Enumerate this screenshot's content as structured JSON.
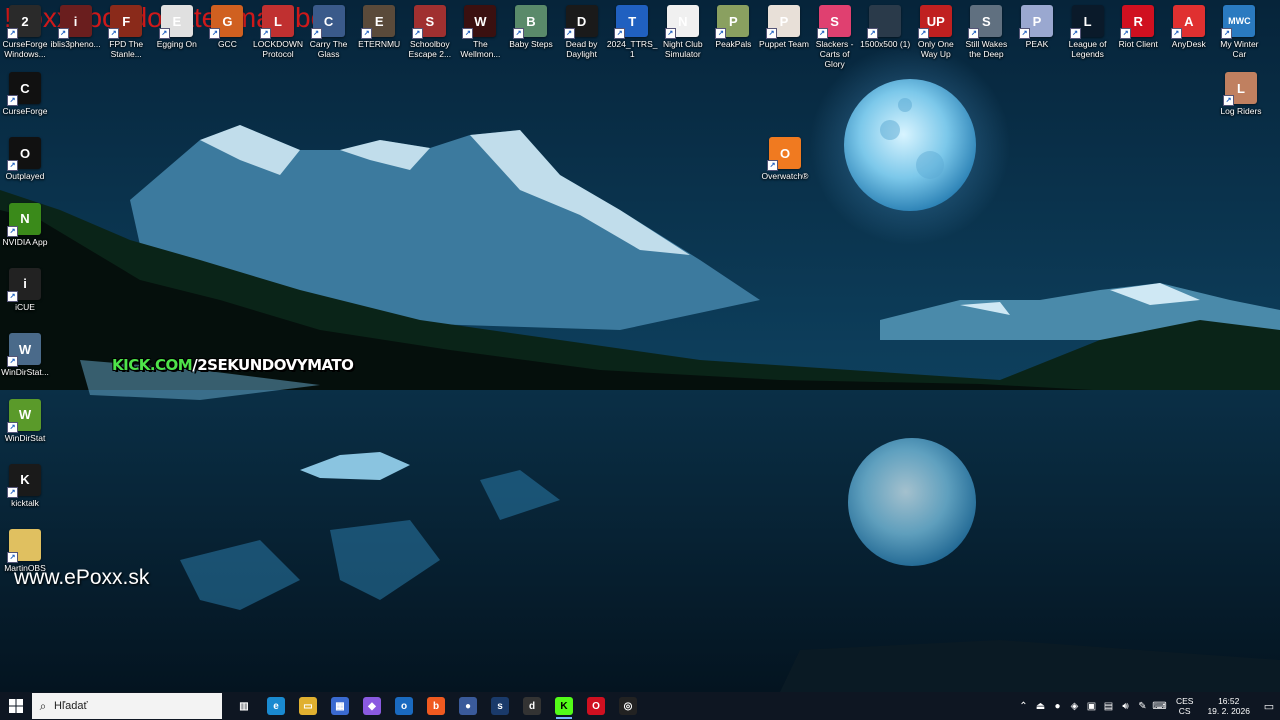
{
  "overlays": {
    "top_banner": "!doxx !pc !donate !matobot",
    "kick_prefix": "KICK.COM",
    "kick_suffix": "/2SEKUNDOVYMATO",
    "website": "www.ePoxx.sk"
  },
  "desktop_icons_top": [
    {
      "name": "curseforge-windows",
      "label": "CurseForge Windows...",
      "glyph": "2",
      "color": "#2a2a2a"
    },
    {
      "name": "iblis3phenomenon",
      "label": "iblis3pheno...",
      "glyph": "i",
      "color": "#6a1e1e"
    },
    {
      "name": "fpd-stanley",
      "label": "FPD The Stanle...",
      "glyph": "F",
      "color": "#8a2a1a"
    },
    {
      "name": "egging-on",
      "label": "Egging On",
      "glyph": "E",
      "color": "#e0e0e0"
    },
    {
      "name": "gcc",
      "label": "GCC",
      "glyph": "G",
      "color": "#d06020"
    },
    {
      "name": "lockdown-protocol",
      "label": "LOCKDOWN Protocol",
      "glyph": "L",
      "color": "#c03030"
    },
    {
      "name": "carry-the-glass",
      "label": "Carry The Glass",
      "glyph": "C",
      "color": "#3a5a8a"
    },
    {
      "name": "eternmu",
      "label": "ETERNMU",
      "glyph": "E",
      "color": "#5a4a3a"
    },
    {
      "name": "schoolboy-escape",
      "label": "Schoolboy Escape 2...",
      "glyph": "S",
      "color": "#a03030"
    },
    {
      "name": "the-wellmonster",
      "label": "The Wellmon...",
      "glyph": "W",
      "color": "#3a1010"
    },
    {
      "name": "baby-steps",
      "label": "Baby Steps",
      "glyph": "B",
      "color": "#5a8a6a"
    },
    {
      "name": "dead-by-daylight",
      "label": "Dead by Daylight",
      "glyph": "D",
      "color": "#1a1a1a"
    },
    {
      "name": "2024-ttrs",
      "label": "2024_TTRS_1",
      "glyph": "T",
      "color": "#2060c0"
    },
    {
      "name": "night-club-simulator",
      "label": "Night Club Simulator",
      "glyph": "N",
      "color": "#f0f0f0"
    },
    {
      "name": "peakpals",
      "label": "PeakPals",
      "glyph": "P",
      "color": "#8aa060"
    },
    {
      "name": "puppet-team",
      "label": "Puppet Team",
      "glyph": "P",
      "color": "#e8e0d8"
    },
    {
      "name": "slackers",
      "label": "Slackers - Carts of Glory",
      "glyph": "S",
      "color": "#e04070"
    },
    {
      "name": "1500x500",
      "label": "1500x500 (1)",
      "glyph": "",
      "color": "#2a3a4a"
    },
    {
      "name": "only-one-way-up",
      "label": "Only One Way Up",
      "glyph": "UP",
      "color": "#c02020"
    },
    {
      "name": "still-wakes-the-deep",
      "label": "Still Wakes the Deep",
      "glyph": "S",
      "color": "#607080"
    },
    {
      "name": "peak",
      "label": "PEAK",
      "glyph": "P",
      "color": "#9aa8d0"
    },
    {
      "name": "league-of-legends",
      "label": "League of Legends",
      "glyph": "L",
      "color": "#0a1a2a"
    },
    {
      "name": "riot-client",
      "label": "Riot Client",
      "glyph": "R",
      "color": "#d01020"
    },
    {
      "name": "anydesk",
      "label": "AnyDesk",
      "glyph": "A",
      "color": "#e03030"
    },
    {
      "name": "my-winter-car",
      "label": "My Winter Car",
      "glyph": "MWC",
      "color": "#2a7ac0"
    }
  ],
  "desktop_icons_left": [
    {
      "name": "curseforge",
      "label": "CurseForge",
      "glyph": "C",
      "color": "#111111"
    },
    {
      "name": "outplayed",
      "label": "Outplayed",
      "glyph": "O",
      "color": "#111111"
    },
    {
      "name": "nvidia-app",
      "label": "NVIDIA App",
      "glyph": "N",
      "color": "#3a8a1a"
    },
    {
      "name": "icue",
      "label": "iCUE",
      "glyph": "i",
      "color": "#222222"
    },
    {
      "name": "windirstat-portable",
      "label": "WinDirStat...",
      "glyph": "W",
      "color": "#4a6a8a"
    },
    {
      "name": "windirstat",
      "label": "WinDirStat",
      "glyph": "W",
      "color": "#5a9a2a"
    },
    {
      "name": "kicktalk",
      "label": "kicktalk",
      "glyph": "K",
      "color": "#1a1a1a"
    },
    {
      "name": "martinobs",
      "label": "MartinOBS",
      "glyph": "",
      "color": "#e0c060"
    }
  ],
  "desktop_icons_right": [
    {
      "name": "log-riders",
      "label": "Log Riders",
      "glyph": "L",
      "color": "#c08060"
    }
  ],
  "desktop_icons_floating": [
    {
      "name": "overwatch",
      "label": "Overwatch®",
      "glyph": "O",
      "color": "#f07a20"
    }
  ],
  "taskbar": {
    "search_placeholder": "Hľadať",
    "apps": [
      {
        "name": "task-view",
        "glyph": "▥",
        "color": "transparent",
        "active": false
      },
      {
        "name": "edge",
        "glyph": "e",
        "color": "#1a8ad0",
        "active": false
      },
      {
        "name": "file-explorer",
        "glyph": "▭",
        "color": "#e0b030",
        "active": false
      },
      {
        "name": "microsoft-store",
        "glyph": "▦",
        "color": "#3a6ad0",
        "active": false
      },
      {
        "name": "copilot",
        "glyph": "◆",
        "color": "#8a5ae0",
        "active": false
      },
      {
        "name": "outlook",
        "glyph": "o",
        "color": "#1a6ac0",
        "active": false
      },
      {
        "name": "brave",
        "glyph": "b",
        "color": "#f05a20",
        "active": false
      },
      {
        "name": "app-drop",
        "glyph": "●",
        "color": "#3a5a9a",
        "active": false
      },
      {
        "name": "steam",
        "glyph": "s",
        "color": "#1a3a6a",
        "active": false
      },
      {
        "name": "discord-like",
        "glyph": "d",
        "color": "#333333",
        "active": false
      },
      {
        "name": "kick",
        "glyph": "K",
        "color": "#53fc18",
        "active": true
      },
      {
        "name": "opera",
        "glyph": "O",
        "color": "#d01020",
        "active": false
      },
      {
        "name": "obs",
        "glyph": "◎",
        "color": "#222222",
        "active": false
      }
    ],
    "language": {
      "line1": "CES",
      "line2": "CS"
    },
    "time": "16:52",
    "date": "19. 2. 2026"
  }
}
